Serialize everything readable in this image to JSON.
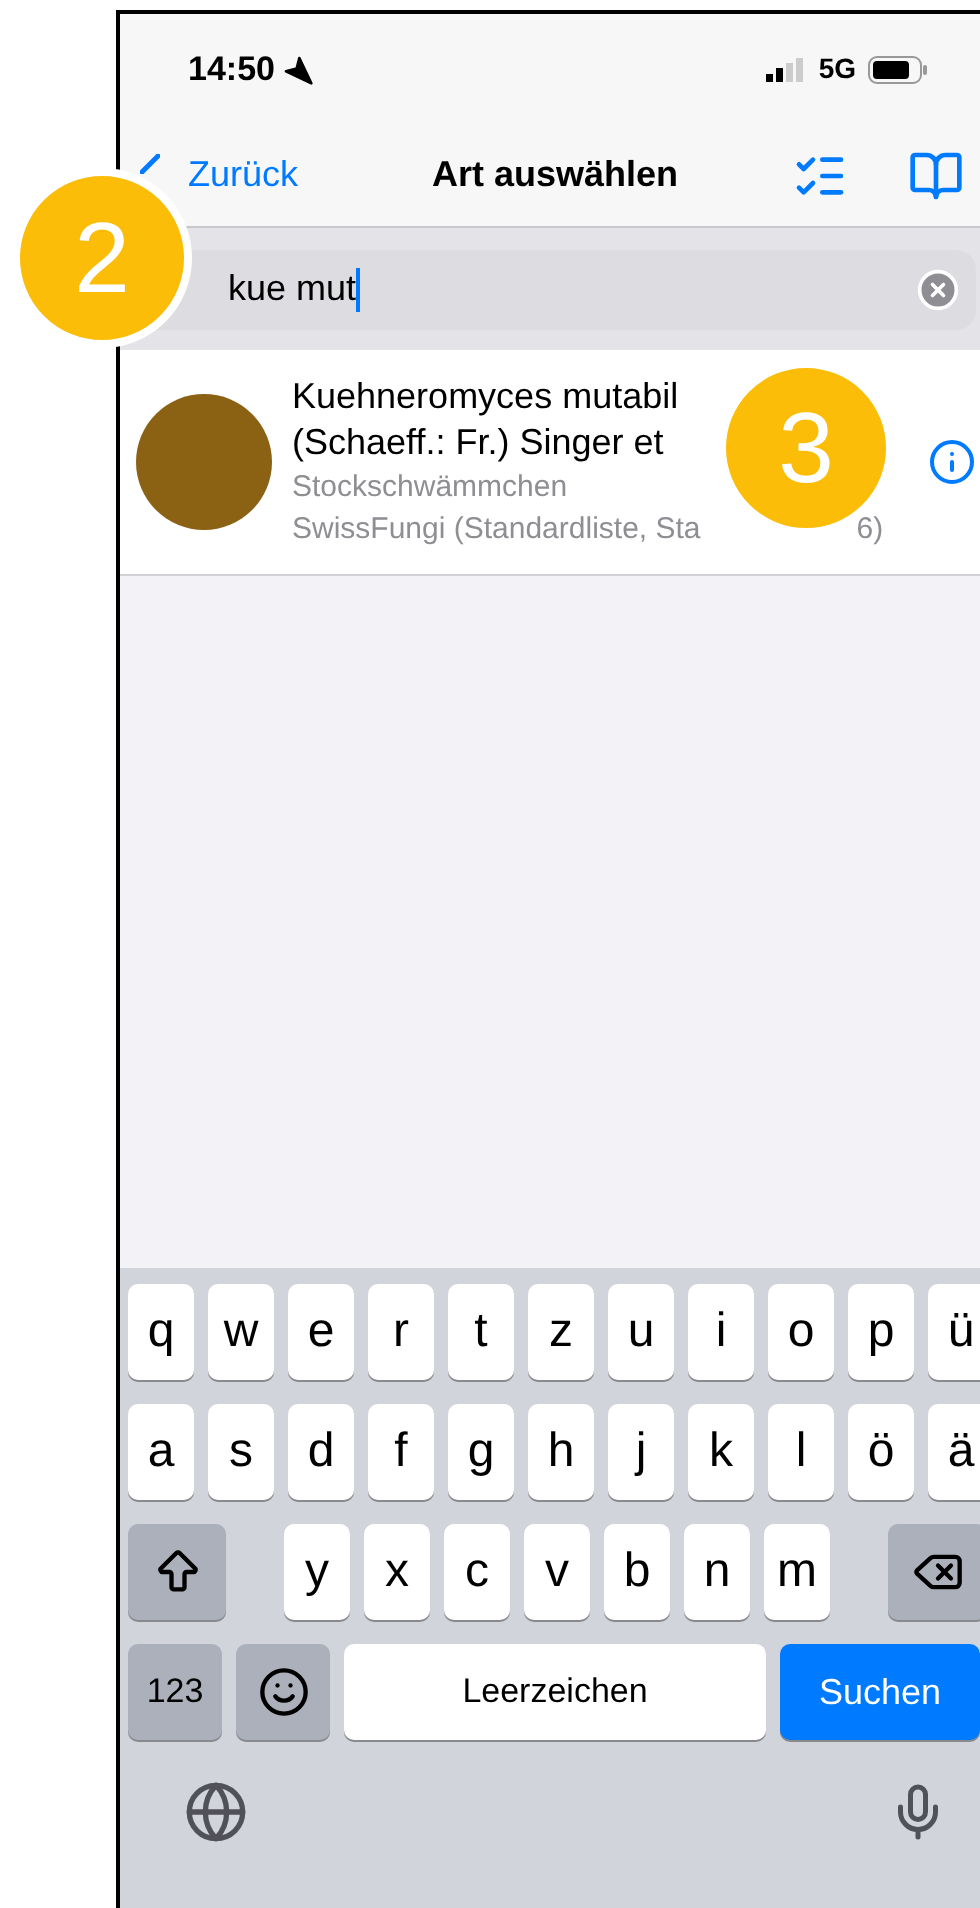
{
  "status_bar": {
    "time": "14:50",
    "network": "5G"
  },
  "nav": {
    "back": "Zurück",
    "title": "Art auswählen"
  },
  "search": {
    "value": "kue mut"
  },
  "results": [
    {
      "title_lines": [
        "Kuehneromyces mutabil",
        "(Schaeff.: Fr.) Singer et"
      ],
      "common_name": "Stockschwämmchen",
      "source_parts": [
        "SwissFungi (Standardliste, Sta",
        "6)"
      ],
      "color": "#8b6114"
    }
  ],
  "callouts": [
    {
      "label": "2"
    },
    {
      "label": "3"
    }
  ],
  "keyboard": {
    "rows": [
      [
        {
          "kind": "letter",
          "label": "q"
        },
        {
          "kind": "letter",
          "label": "w"
        },
        {
          "kind": "letter",
          "label": "e"
        },
        {
          "kind": "letter",
          "label": "r"
        },
        {
          "kind": "letter",
          "label": "t"
        },
        {
          "kind": "letter",
          "label": "z"
        },
        {
          "kind": "letter",
          "label": "u"
        },
        {
          "kind": "letter",
          "label": "i"
        },
        {
          "kind": "letter",
          "label": "o"
        },
        {
          "kind": "letter",
          "label": "p"
        },
        {
          "kind": "letter",
          "label": "ü"
        }
      ],
      [
        {
          "kind": "letter",
          "label": "a"
        },
        {
          "kind": "letter",
          "label": "s"
        },
        {
          "kind": "letter",
          "label": "d"
        },
        {
          "kind": "letter",
          "label": "f"
        },
        {
          "kind": "letter",
          "label": "g"
        },
        {
          "kind": "letter",
          "label": "h"
        },
        {
          "kind": "letter",
          "label": "j"
        },
        {
          "kind": "letter",
          "label": "k"
        },
        {
          "kind": "letter",
          "label": "l"
        },
        {
          "kind": "letter",
          "label": "ö"
        },
        {
          "kind": "letter",
          "label": "ä"
        }
      ],
      [
        {
          "kind": "shift"
        },
        {
          "kind": "gap"
        },
        {
          "kind": "letter",
          "label": "y"
        },
        {
          "kind": "letter",
          "label": "x"
        },
        {
          "kind": "letter",
          "label": "c"
        },
        {
          "kind": "letter",
          "label": "v"
        },
        {
          "kind": "letter",
          "label": "b"
        },
        {
          "kind": "letter",
          "label": "n"
        },
        {
          "kind": "letter",
          "label": "m"
        },
        {
          "kind": "gap"
        },
        {
          "kind": "delete"
        }
      ]
    ],
    "numbers": "123",
    "space": "Leerzeichen",
    "action": "Suchen"
  }
}
